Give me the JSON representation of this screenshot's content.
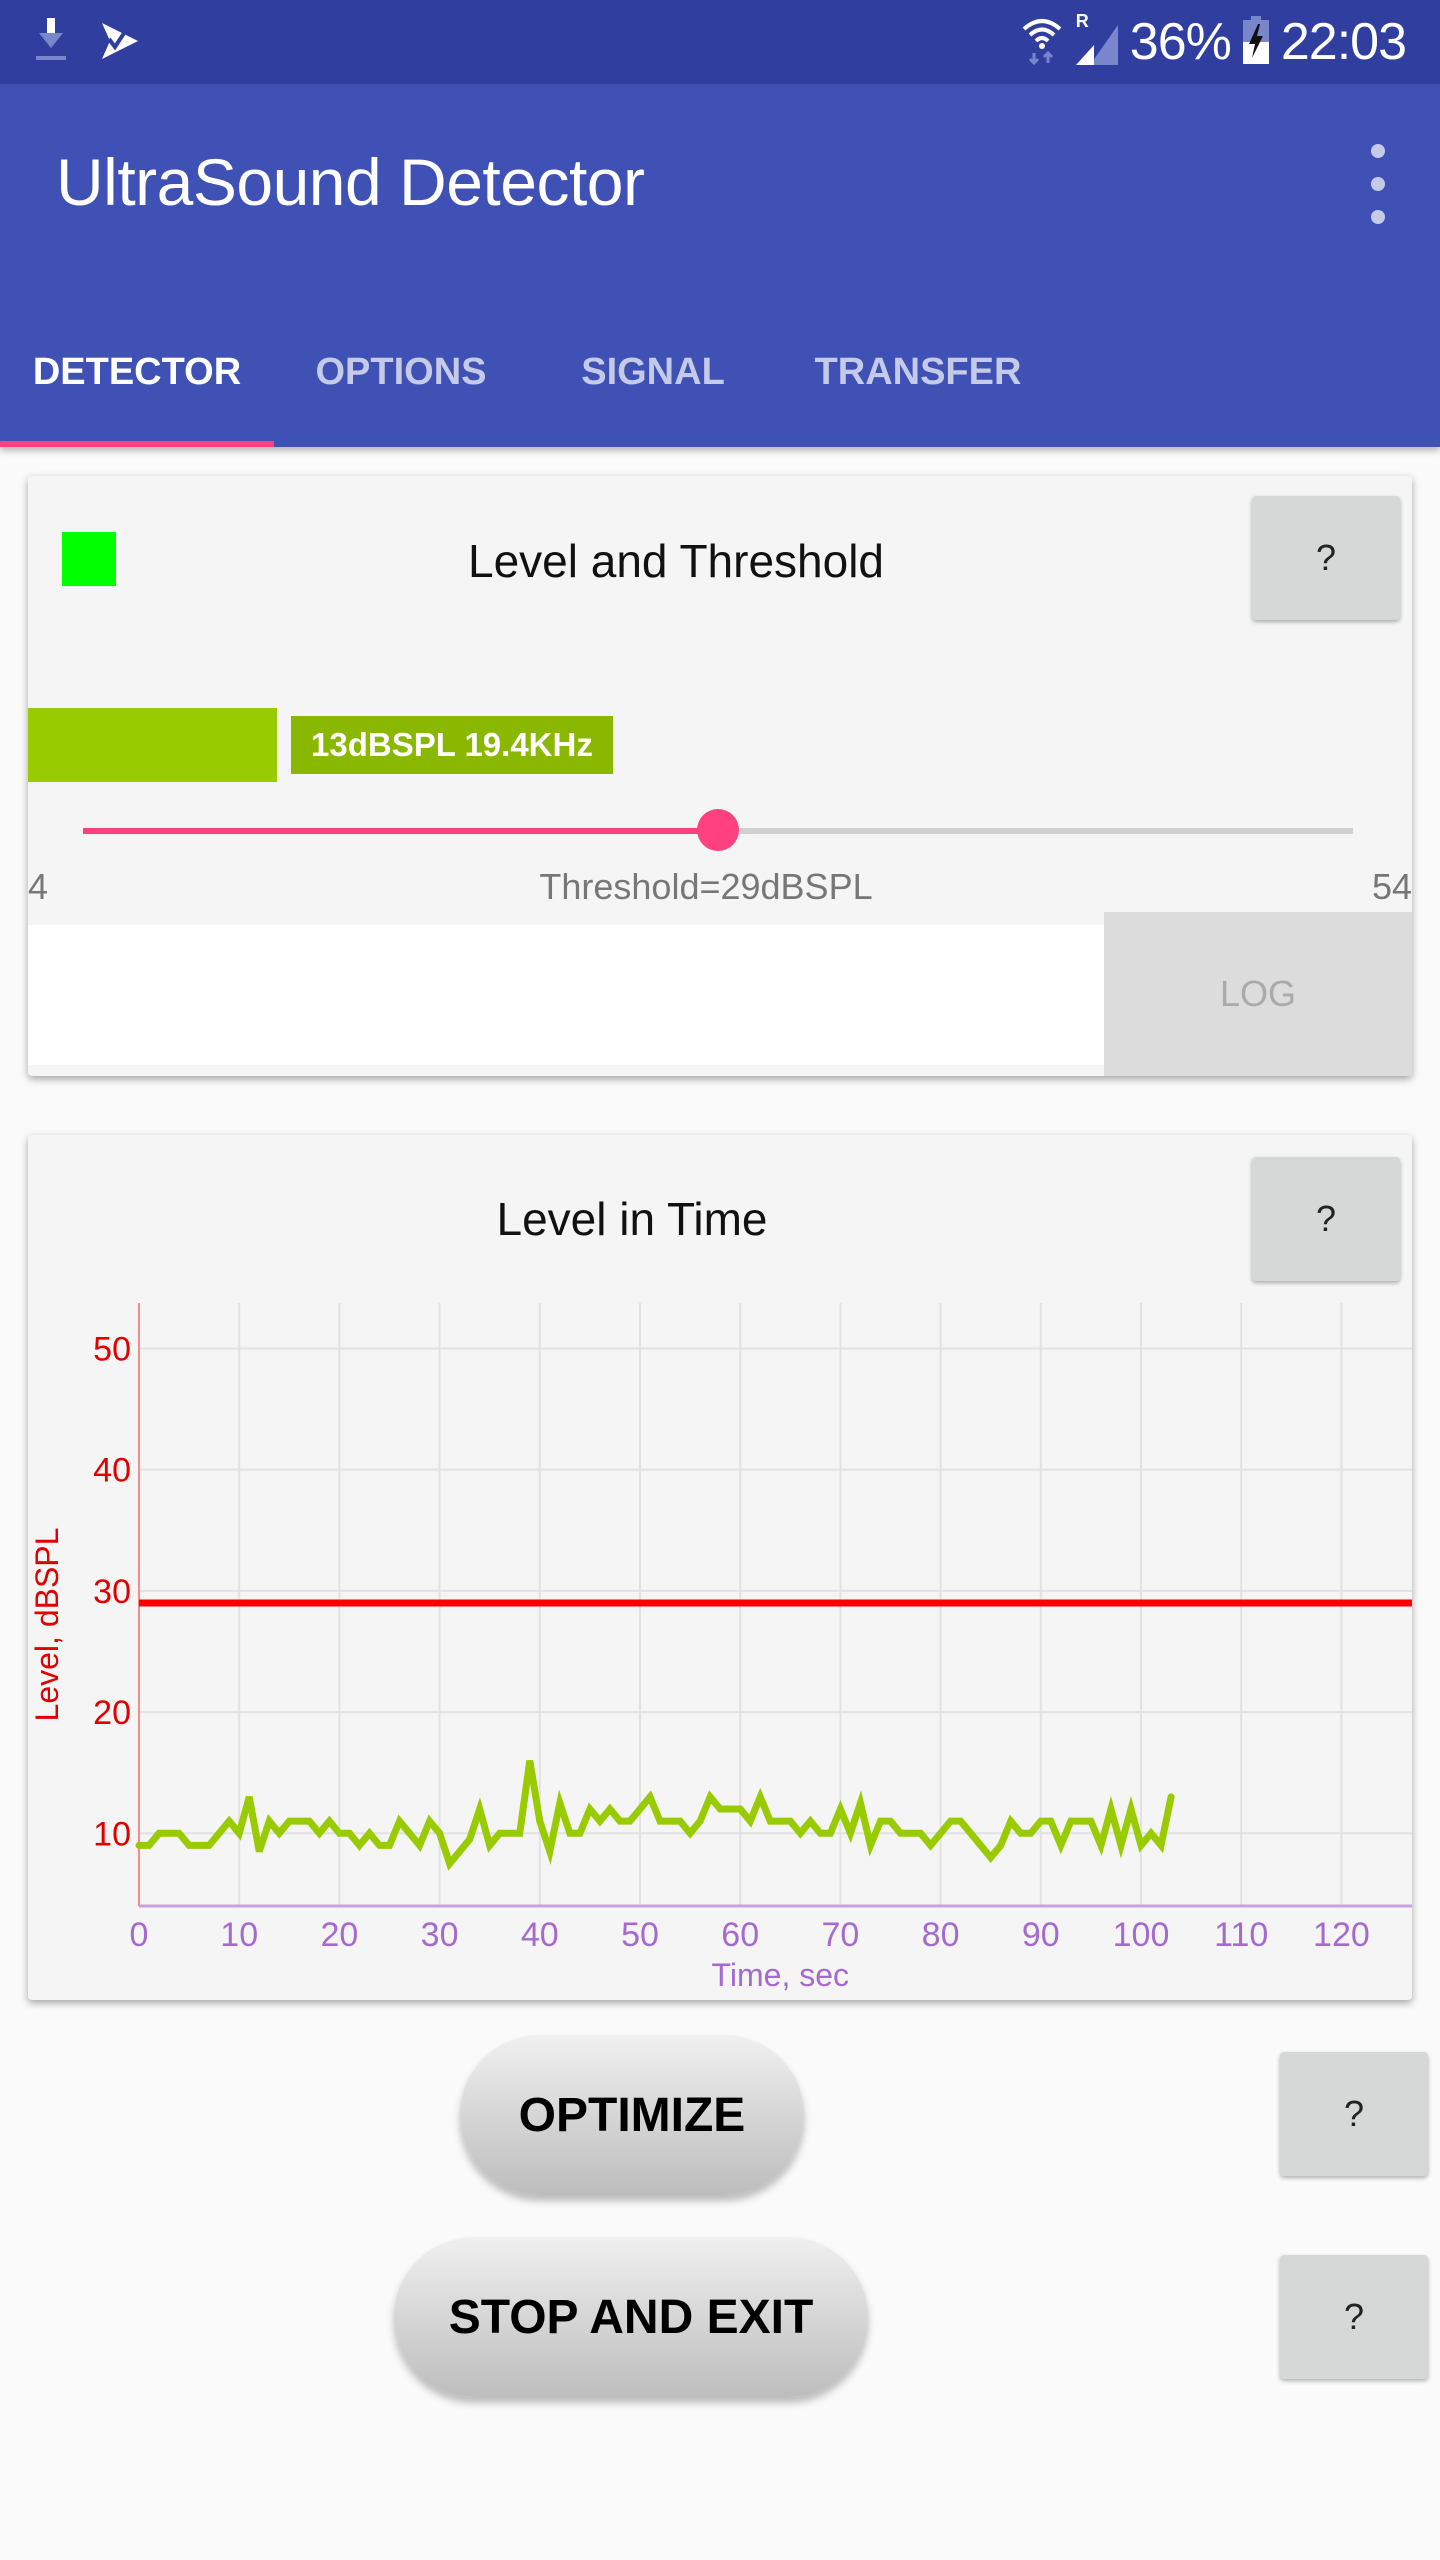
{
  "status_bar": {
    "left_icons": [
      "download-icon",
      "play-store-check-icon"
    ],
    "right_icons": [
      "wifi-icon",
      "signal-roaming-icon",
      "battery-charging-icon"
    ],
    "roaming_label": "R",
    "battery_percent": "36%",
    "time": "22:03"
  },
  "app_bar": {
    "title": "UltraSound Detector",
    "menu_icon": "more-vert-icon"
  },
  "tabs": [
    {
      "label": "DETECTOR",
      "active": true
    },
    {
      "label": "OPTIONS",
      "active": false
    },
    {
      "label": "SIGNAL",
      "active": false
    },
    {
      "label": "TRANSFER",
      "active": false
    }
  ],
  "level_card": {
    "title": "Level and Threshold",
    "help_label": "?",
    "indicator_color": "#00ff00",
    "level_label": "13dBSPL 19.4KHz",
    "level_dbspl": 13,
    "slider": {
      "min_label": "4",
      "max_label": "54",
      "min": 4,
      "max": 54,
      "value": 29
    },
    "threshold_label": "Threshold=29dBSPL",
    "log_button": "LOG",
    "log_text": ""
  },
  "time_card": {
    "title": "Level in Time",
    "help_label": "?"
  },
  "chart_data": {
    "type": "line",
    "title": "Level in Time",
    "xlabel": "Time, sec",
    "ylabel": "Level, dBSPL",
    "xlim": [
      0,
      128
    ],
    "ylim": [
      4,
      53
    ],
    "x_ticks": [
      0,
      10,
      20,
      30,
      40,
      50,
      60,
      70,
      80,
      90,
      100,
      110,
      120
    ],
    "y_ticks": [
      10,
      20,
      30,
      40,
      50
    ],
    "grid": true,
    "threshold": 29,
    "series": [
      {
        "name": "Level",
        "color": "#99cc00",
        "x": [
          0,
          1,
          2,
          3,
          4,
          5,
          6,
          7,
          8,
          9,
          10,
          11,
          12,
          13,
          14,
          15,
          16,
          17,
          18,
          19,
          20,
          21,
          22,
          23,
          24,
          25,
          26,
          27,
          28,
          29,
          30,
          31,
          32,
          33,
          34,
          35,
          36,
          37,
          38,
          39,
          40,
          41,
          42,
          43,
          44,
          45,
          46,
          47,
          48,
          49,
          50,
          51,
          52,
          53,
          54,
          55,
          56,
          57,
          58,
          59,
          60,
          61,
          62,
          63,
          64,
          65,
          66,
          67,
          68,
          69,
          70,
          71,
          72,
          73,
          74,
          75,
          76,
          77,
          78,
          79,
          80,
          81,
          82,
          83,
          84,
          85,
          86,
          87,
          88,
          89,
          90,
          91,
          92,
          93,
          94,
          95,
          96,
          97,
          98,
          99,
          100,
          101,
          102,
          103
        ],
        "values": [
          9,
          9,
          10,
          10,
          10,
          9,
          9,
          9,
          10,
          11,
          10,
          13,
          8.5,
          11,
          10,
          11,
          11,
          11,
          10,
          11,
          10,
          10,
          9,
          10,
          9,
          9,
          11,
          10,
          9,
          11,
          10,
          7.5,
          8.5,
          9.5,
          12,
          9,
          10,
          10,
          10,
          16,
          11,
          8.5,
          12.5,
          10,
          10,
          12,
          11,
          12,
          11,
          11,
          12,
          13,
          11,
          11,
          11,
          10,
          11,
          13,
          12,
          12,
          12,
          11,
          13,
          11,
          11,
          11,
          10,
          11,
          10,
          10,
          12,
          10,
          12.5,
          9,
          11,
          11,
          10,
          10,
          10,
          9,
          10,
          11,
          11,
          10,
          9,
          8,
          9,
          11,
          10,
          10,
          11,
          11,
          9,
          11,
          11,
          11,
          9,
          12,
          9,
          12,
          9,
          10,
          9,
          13
        ]
      }
    ]
  },
  "buttons": {
    "optimize": "OPTIMIZE",
    "stop_and_exit": "STOP AND EXIT",
    "help_label": "?"
  }
}
